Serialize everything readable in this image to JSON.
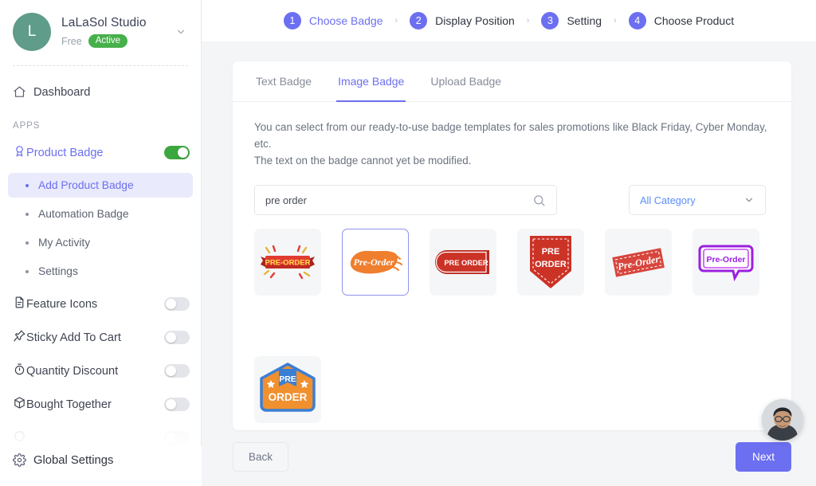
{
  "account": {
    "initial": "L",
    "name": "LaLaSol Studio",
    "plan": "Free",
    "status": "Active",
    "avatar_color": "#5f9c8a",
    "status_color": "#47b04b"
  },
  "sidebar": {
    "dashboard_label": "Dashboard",
    "section_label": "APPS",
    "apps": [
      {
        "label": "Product Badge",
        "icon": "badge-icon",
        "toggle": "on",
        "active": true
      },
      {
        "label": "Feature Icons",
        "icon": "document-icon",
        "toggle": "off",
        "active": false
      },
      {
        "label": "Sticky Add To Cart",
        "icon": "pin-icon",
        "toggle": "off",
        "active": false
      },
      {
        "label": "Quantity Discount",
        "icon": "timer-icon",
        "toggle": "off",
        "active": false
      },
      {
        "label": "Bought Together",
        "icon": "box-icon",
        "toggle": "off",
        "active": false
      }
    ],
    "sub_items": [
      {
        "label": "Add Product Badge",
        "selected": true
      },
      {
        "label": "Automation Badge",
        "selected": false
      },
      {
        "label": "My Activity",
        "selected": false
      },
      {
        "label": "Settings",
        "selected": false
      }
    ],
    "global_settings_label": "Global Settings",
    "accent_color": "#6c6ff0"
  },
  "stepper": {
    "steps": [
      {
        "num": "1",
        "label": "Choose Badge",
        "active": true
      },
      {
        "num": "2",
        "label": "Display Position",
        "active": false
      },
      {
        "num": "3",
        "label": "Setting",
        "active": false
      },
      {
        "num": "4",
        "label": "Choose Product",
        "active": false
      }
    ],
    "separator": "›"
  },
  "card": {
    "tabs": [
      {
        "label": "Text Badge",
        "active": false
      },
      {
        "label": "Image Badge",
        "active": true
      },
      {
        "label": "Upload Badge",
        "active": false
      }
    ],
    "description_line1": "You can select from our ready-to-use badge templates for sales promotions like Black Friday, Cyber Monday, etc.",
    "description_line2": "The text on the badge cannot yet be modified.",
    "search": {
      "value": "pre order",
      "placeholder": "Search"
    },
    "category": {
      "value": "All Category"
    },
    "badges": [
      {
        "id": "ribbon-red",
        "label": "PRE-ORDER",
        "selected": false
      },
      {
        "id": "brush-orange",
        "label": "Pre-Order",
        "selected": true
      },
      {
        "id": "pill-red",
        "label": "PRE ORDER",
        "selected": false
      },
      {
        "id": "pennant-red",
        "label": "PRE ORDER",
        "selected": false
      },
      {
        "id": "ticket-red",
        "label": "Pre-Order",
        "selected": false
      },
      {
        "id": "bubble-purple",
        "label": "Pre-Order",
        "selected": false
      },
      {
        "id": "shield-orange",
        "label": "PRE ORDER",
        "selected": false
      }
    ]
  },
  "footer": {
    "back_label": "Back",
    "next_label": "Next",
    "next_color": "#6c6ff0"
  }
}
